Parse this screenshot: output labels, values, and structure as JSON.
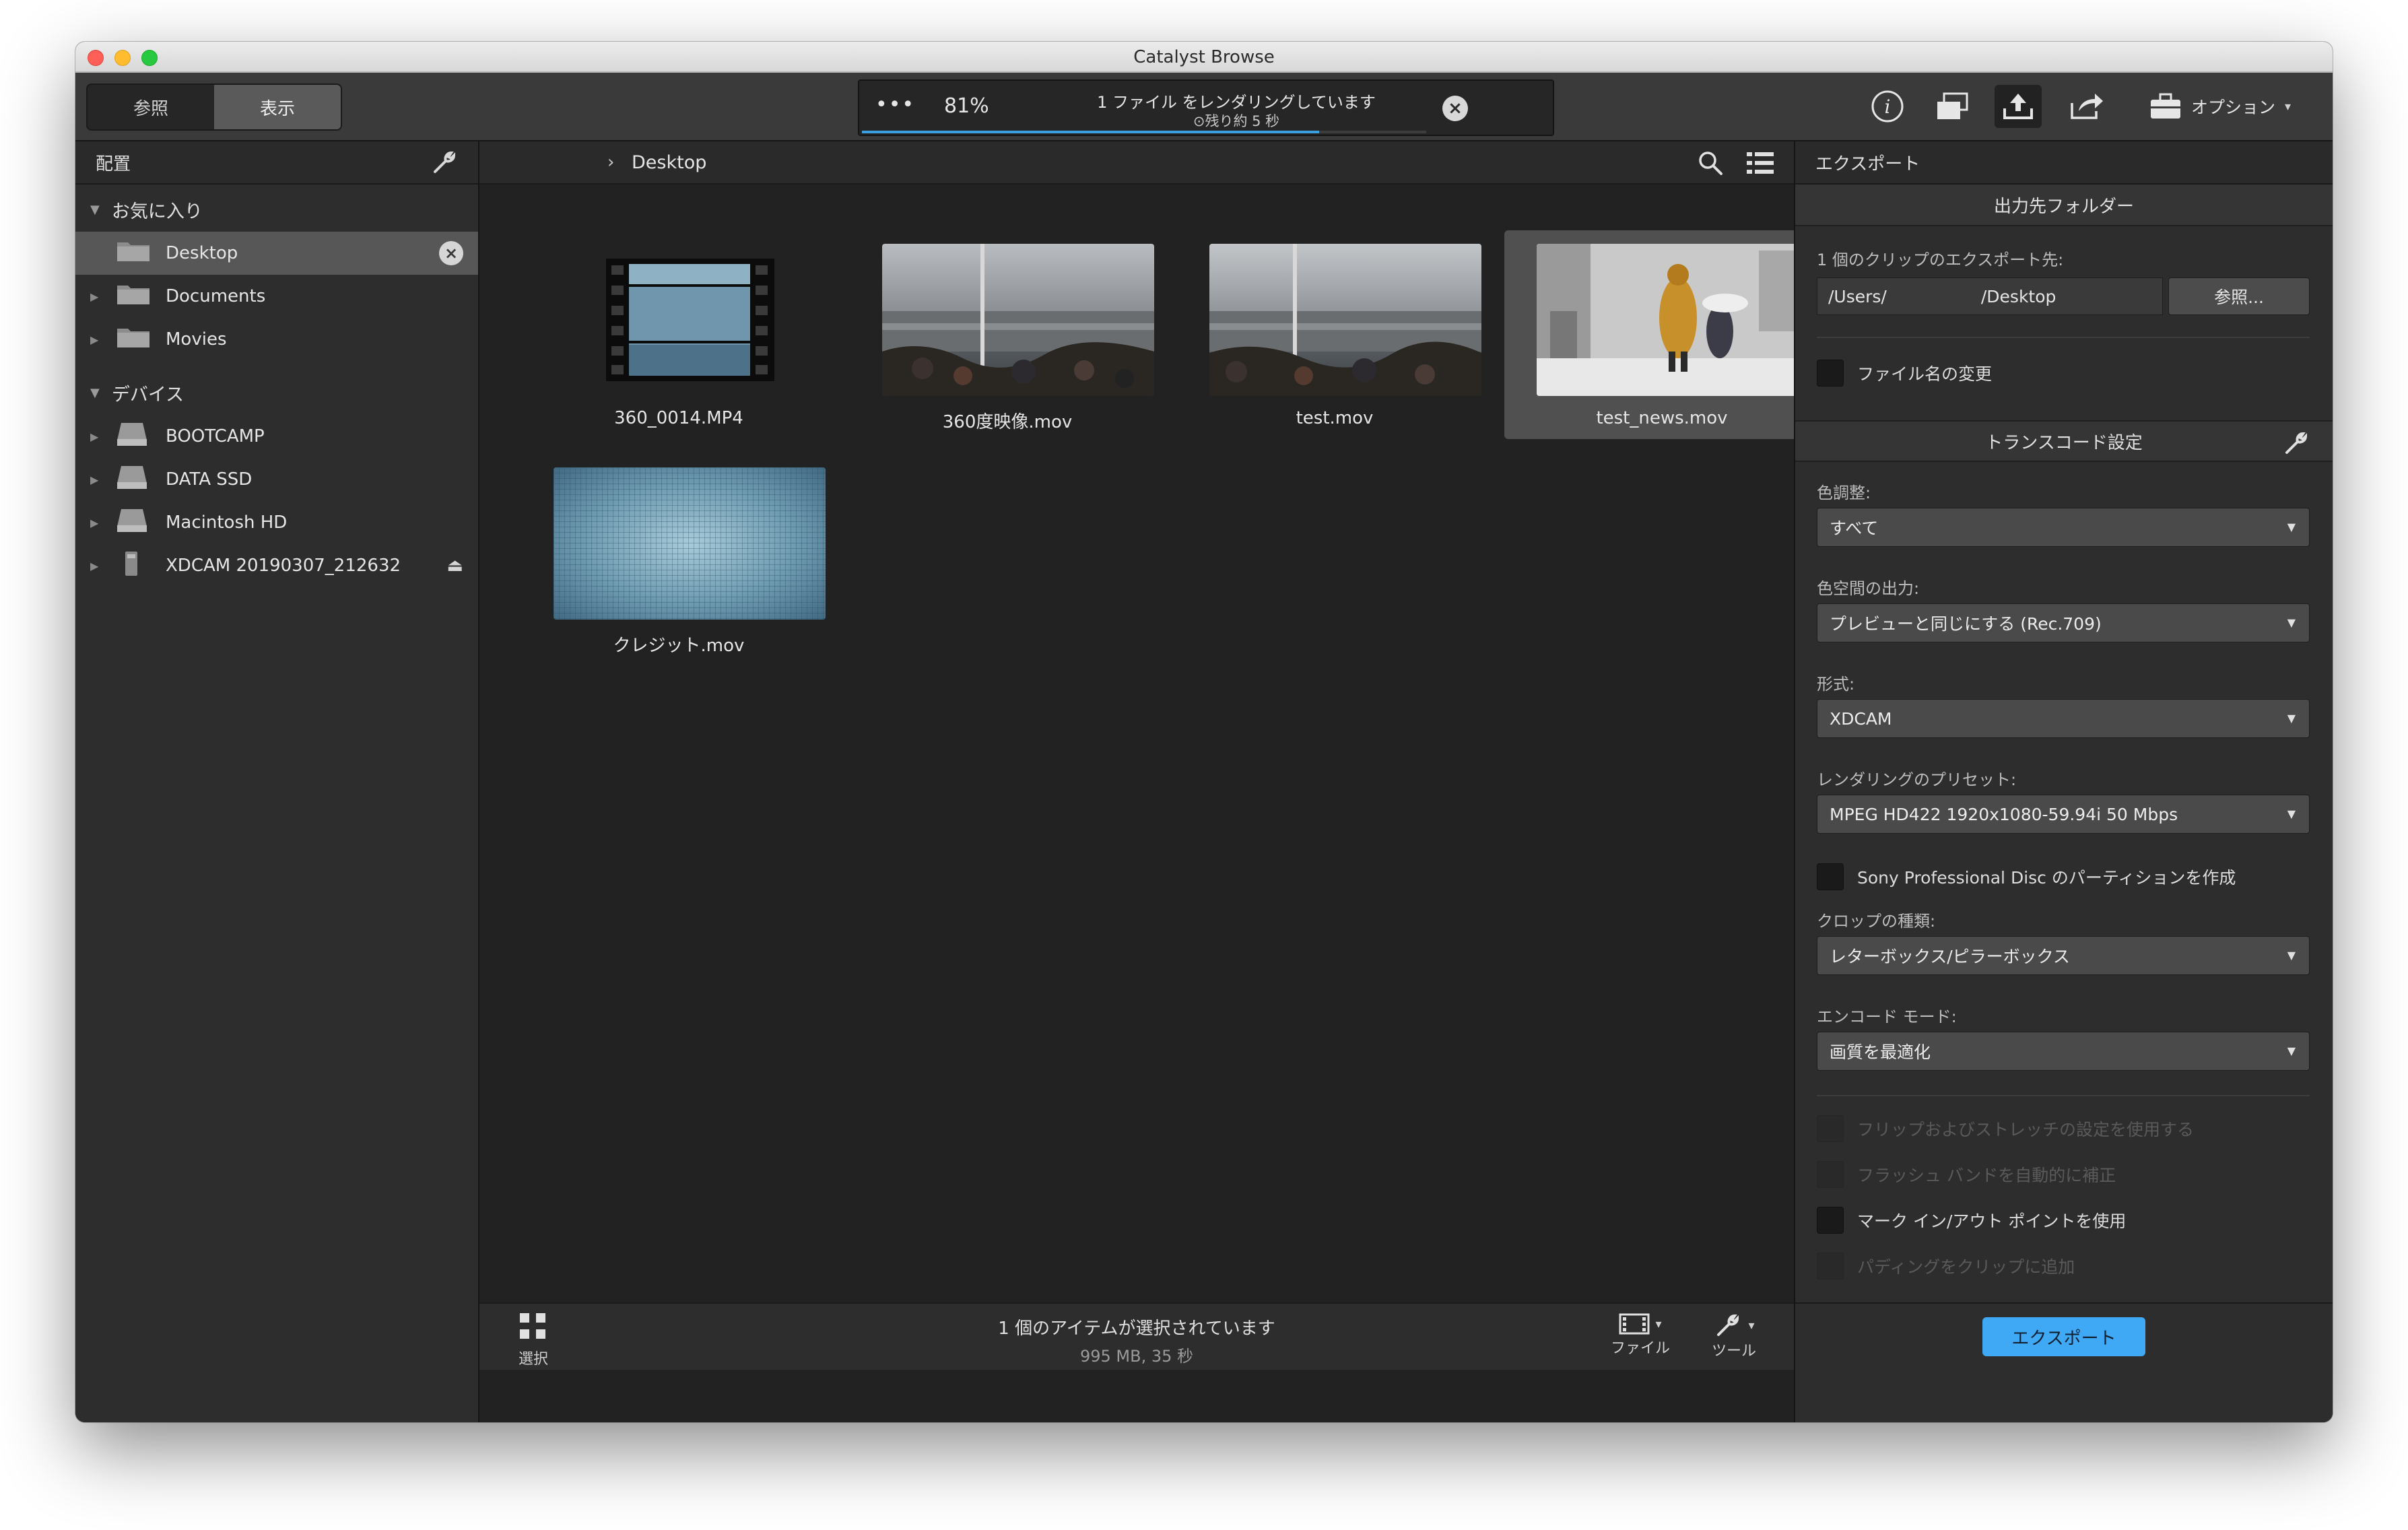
{
  "window": {
    "title": "Catalyst Browse"
  },
  "toolbar": {
    "tabs": [
      {
        "label": "参照"
      },
      {
        "label": "表示"
      }
    ],
    "progress": {
      "dots": "•••",
      "percent_text": "81%",
      "percent": 81,
      "message": "1 ファイル をレンダリングしています",
      "remaining": "⊙残り約 5 秒"
    },
    "options_label": "オプション"
  },
  "sidebar": {
    "header": "配置",
    "favorites_label": "お気に入り",
    "favorites": [
      {
        "label": "Desktop",
        "selected": true
      },
      {
        "label": "Documents"
      },
      {
        "label": "Movies"
      }
    ],
    "devices_label": "デバイス",
    "devices": [
      {
        "label": "BOOTCAMP"
      },
      {
        "label": "DATA SSD"
      },
      {
        "label": "Macintosh HD"
      },
      {
        "label": "XDCAM 20190307_212632"
      }
    ]
  },
  "main": {
    "breadcrumb": "Desktop",
    "files": [
      {
        "name": "360_0014.MP4"
      },
      {
        "name": "360度映像.mov"
      },
      {
        "name": "test.mov"
      },
      {
        "name": "test_news.mov",
        "selected": true
      },
      {
        "name": "クレジット.mov"
      }
    ],
    "status": {
      "main": "1 個のアイテムが選択されています",
      "sub": "995 MB, 35 秒"
    },
    "bottom_tools": {
      "select_label": "選択",
      "file_label": "ファイル",
      "tool_label": "ツール"
    }
  },
  "export_panel": {
    "header": "エクスポート",
    "dest_section": "出力先フォルダー",
    "dest_label": "1 個のクリップのエクスポート先:",
    "path_left": "/Users/",
    "path_right": "/Desktop",
    "browse_label": "参照...",
    "rename_label": "ファイル名の変更",
    "transcode_section": "トランスコード設定",
    "color_adjust_label": "色調整:",
    "color_adjust_value": "すべて",
    "color_space_label": "色空間の出力:",
    "color_space_value": "プレビューと同じにする (Rec.709)",
    "format_label": "形式:",
    "format_value": "XDCAM",
    "preset_label": "レンダリングのプリセット:",
    "preset_value": "MPEG HD422 1920x1080-59.94i 50 Mbps",
    "sony_disc_label": "Sony Professional Disc のパーティションを作成",
    "crop_label": "クロップの種類:",
    "crop_value": "レターボックス/ピラーボックス",
    "encode_label": "エンコード モード:",
    "encode_value": "画質を最適化",
    "flip_label": "フリップおよびストレッチの設定を使用する",
    "flash_label": "フラッシュ バンドを自動的に補正",
    "mark_label": "マーク イン/アウト ポイントを使用",
    "padding_label": "パディングをクリップに追加",
    "export_button": "エクスポート"
  }
}
